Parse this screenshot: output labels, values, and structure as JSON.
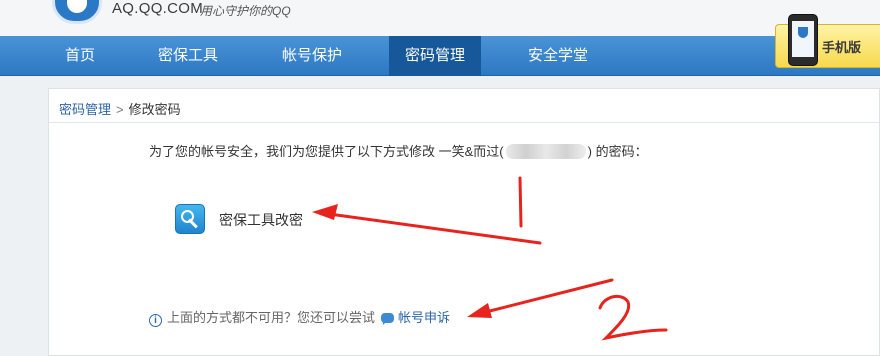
{
  "header": {
    "logo_text": "AQ.QQ.COM",
    "slogan": "用心守护你的QQ",
    "mobile_badge": "手机版"
  },
  "nav": {
    "items": [
      {
        "label": "首页"
      },
      {
        "label": "密保工具"
      },
      {
        "label": "帐号保护"
      },
      {
        "label": "密码管理"
      },
      {
        "label": "安全学堂"
      }
    ],
    "active": "密码管理"
  },
  "breadcrumb": {
    "parent": "密码管理",
    "separator": ">",
    "current": "修改密码"
  },
  "content": {
    "intro_prefix": "为了您的帐号安全，我们为您提供了以下方式修改 一笑&而过(",
    "intro_suffix": ") 的密码：",
    "method_label": "密保工具改密",
    "hint_text": "上面的方式都不可用？您还可以尝试",
    "appeal_label": "帐号申诉"
  },
  "annotations": {
    "arrow_color": "#e8221c",
    "marks": [
      "1",
      "2"
    ]
  },
  "colors": {
    "nav": "#2c79c3",
    "nav_active": "#17589a",
    "link": "#2b66a9"
  }
}
